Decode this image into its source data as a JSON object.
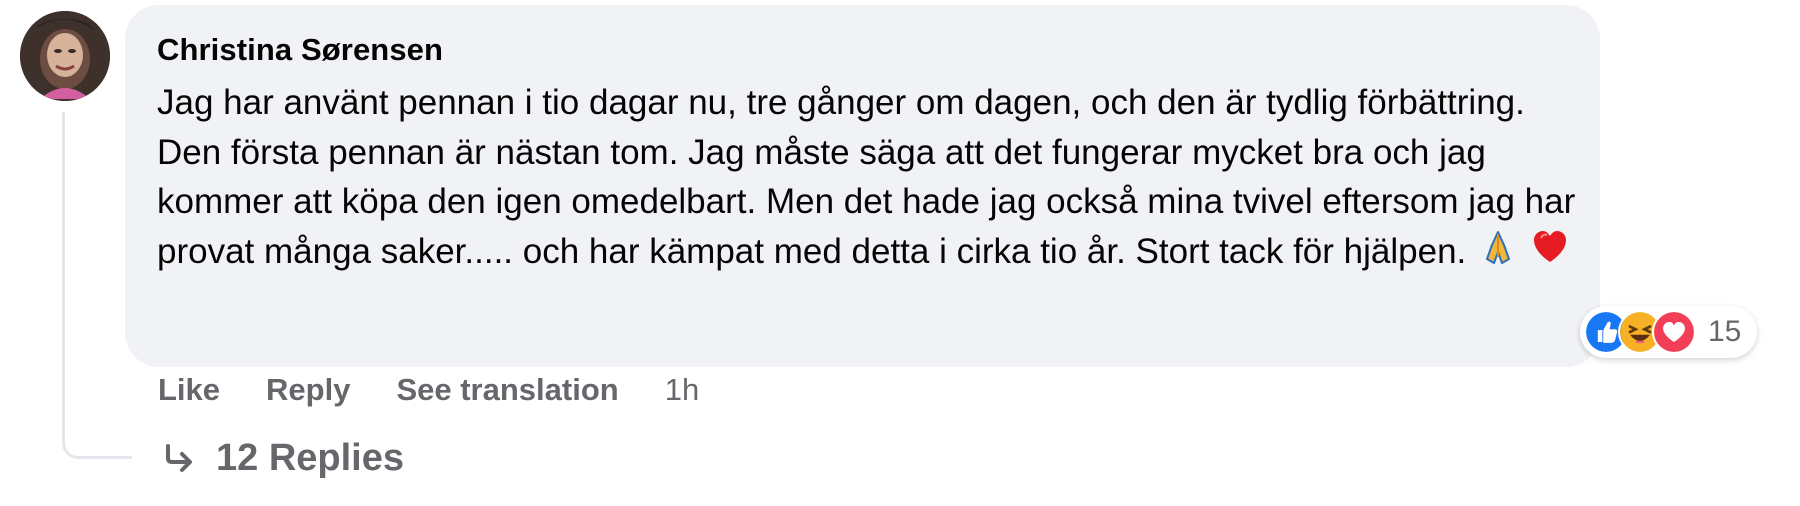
{
  "comment": {
    "author": "Christina Sørensen",
    "text": "Jag har använt pennan i tio dagar nu, tre gånger om dagen, och den är tydlig förbättring. Den första pennan är nästan tom. Jag måste säga att det fungerar mycket bra och jag kommer att köpa den igen omedelbart. Men det hade jag också mina tvivel eftersom jag har provat många saker..... och har kämpat med detta i cirka tio år. Stort tack för hjälpen.",
    "trailing_emojis": [
      "folded-hands-icon",
      "red-heart-icon"
    ]
  },
  "reactions": {
    "types": [
      "like-icon",
      "haha-icon",
      "love-icon"
    ],
    "count": "15",
    "colors": {
      "like": "#1877f2",
      "haha": "#f7b125",
      "love": "#f33e58"
    }
  },
  "actions": {
    "like": "Like",
    "reply": "Reply",
    "see_translation": "See translation",
    "time": "1h"
  },
  "replies": {
    "label": "12 Replies"
  }
}
